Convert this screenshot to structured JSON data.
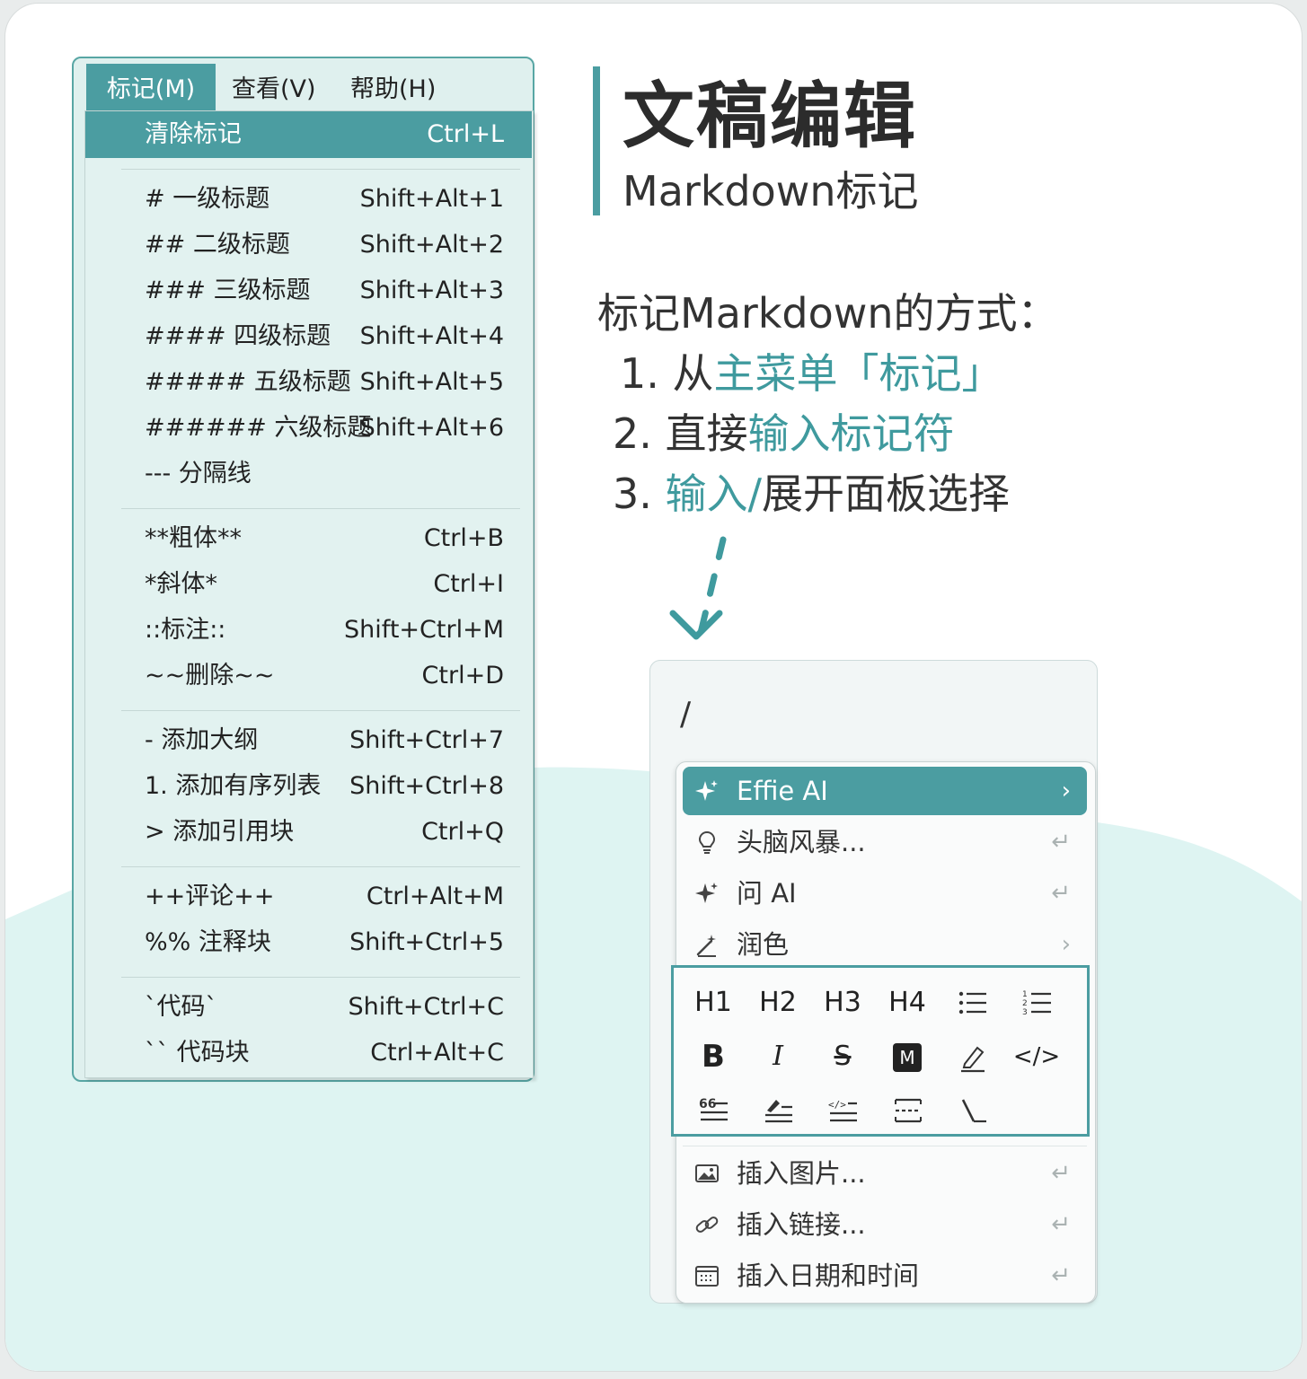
{
  "menu": {
    "menubar": [
      {
        "label": "标记(M)",
        "active": true
      },
      {
        "label": "查看(V)",
        "active": false
      },
      {
        "label": "帮助(H)",
        "active": false
      }
    ],
    "items": [
      {
        "label": "清除标记",
        "shortcut": "Ctrl+L",
        "highlighted": true
      },
      {
        "label": "# 一级标题",
        "shortcut": "Shift+Alt+1"
      },
      {
        "label": "## 二级标题",
        "shortcut": "Shift+Alt+2"
      },
      {
        "label": "### 三级标题",
        "shortcut": "Shift+Alt+3"
      },
      {
        "label": "#### 四级标题",
        "shortcut": "Shift+Alt+4"
      },
      {
        "label": "##### 五级标题",
        "shortcut": "Shift+Alt+5"
      },
      {
        "label": "###### 六级标题",
        "shortcut": "Shift+Alt+6"
      },
      {
        "label": "--- 分隔线",
        "shortcut": ""
      },
      {
        "label": "**粗体**",
        "shortcut": "Ctrl+B"
      },
      {
        "label": "*斜体*",
        "shortcut": "Ctrl+I"
      },
      {
        "label": "::标注::",
        "shortcut": "Shift+Ctrl+M"
      },
      {
        "label": "~~删除~~",
        "shortcut": "Ctrl+D"
      },
      {
        "label": "- 添加大纲",
        "shortcut": "Shift+Ctrl+7"
      },
      {
        "label": "1. 添加有序列表",
        "shortcut": "Shift+Ctrl+8"
      },
      {
        "label": "> 添加引用块",
        "shortcut": "Ctrl+Q"
      },
      {
        "label": "++评论++",
        "shortcut": "Ctrl+Alt+M"
      },
      {
        "label": "%% 注释块",
        "shortcut": "Shift+Ctrl+5"
      },
      {
        "label": "`代码`",
        "shortcut": "Shift+Ctrl+C"
      },
      {
        "label": "`` 代码块",
        "shortcut": "Ctrl+Alt+C"
      }
    ]
  },
  "header": {
    "title": "文稿编辑",
    "subtitle": "Markdown标记"
  },
  "intro": "标记Markdown的方式：",
  "steps": [
    {
      "num": "1.",
      "pre": "从",
      "highlight": "主菜单「标记」",
      "post": ""
    },
    {
      "num": "2.",
      "pre": "直接",
      "highlight": "输入标记符",
      "post": ""
    },
    {
      "num": "3.",
      "pre": "",
      "highlight": "输入/",
      "post": "展开面板选择"
    }
  ],
  "editor": {
    "slash": "/"
  },
  "popup": {
    "ai_item": {
      "label": "Effie AI",
      "trail": "›",
      "icon": "sparkle-icon"
    },
    "ai_sub": [
      {
        "label": "头脑风暴...",
        "trail": "↵",
        "icon": "lightbulb-icon"
      },
      {
        "label": "问 AI",
        "trail": "↵",
        "icon": "sparkle-icon"
      },
      {
        "label": "润色",
        "trail": "›",
        "icon": "magic-wand-icon"
      }
    ],
    "format_rows": [
      [
        {
          "label": "H1",
          "icon": "heading-1-icon"
        },
        {
          "label": "H2",
          "icon": "heading-2-icon"
        },
        {
          "label": "H3",
          "icon": "heading-3-icon"
        },
        {
          "label": "H4",
          "icon": "heading-4-icon"
        },
        {
          "label": "",
          "icon": "bullet-list-icon"
        },
        {
          "label": "",
          "icon": "numbered-list-icon"
        }
      ],
      [
        {
          "label": "B",
          "icon": "bold-icon"
        },
        {
          "label": "I",
          "icon": "italic-icon"
        },
        {
          "label": "S",
          "icon": "strikethrough-icon"
        },
        {
          "label": "M",
          "icon": "mark-icon"
        },
        {
          "label": "",
          "icon": "highlighter-icon"
        },
        {
          "label": "</>",
          "icon": "inline-code-icon"
        }
      ],
      [
        {
          "label": "",
          "icon": "quote-block-icon"
        },
        {
          "label": "",
          "icon": "comment-block-icon"
        },
        {
          "label": "",
          "icon": "code-block-icon"
        },
        {
          "label": "",
          "icon": "divider-icon"
        },
        {
          "label": "",
          "icon": "latex-icon"
        }
      ]
    ],
    "insert_items": [
      {
        "label": "插入图片...",
        "trail": "↵",
        "icon": "image-icon"
      },
      {
        "label": "插入链接...",
        "trail": "↵",
        "icon": "link-icon"
      },
      {
        "label": "插入日期和时间",
        "trail": "↵",
        "icon": "calendar-icon"
      }
    ]
  },
  "colors": {
    "accent": "#4b9da1",
    "menu_bg": "#e2f2f0",
    "wave": "#dcf3f1"
  }
}
